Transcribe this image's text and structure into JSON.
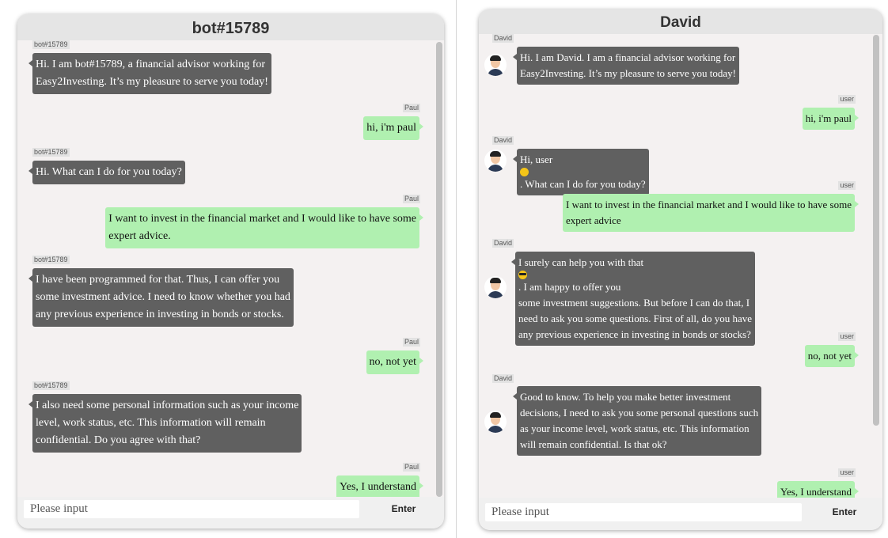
{
  "left_chat": {
    "title": "bot#15789",
    "input_placeholder": "Please input",
    "enter_label": "Enter",
    "messages": [
      {
        "sender": "bot#15789",
        "role": "bot",
        "lines": [
          "Hi. I am bot#15789, a financial advisor working for",
          "Easy2Investing. It’s my pleasure to serve you today!"
        ]
      },
      {
        "sender": "Paul",
        "role": "user",
        "lines": [
          "hi, i'm paul"
        ]
      },
      {
        "sender": "bot#15789",
        "role": "bot",
        "lines": [
          "Hi. What can I do for you today?"
        ]
      },
      {
        "sender": "Paul",
        "role": "user",
        "lines": [
          "I want to invest in the financial market and I would like to have some",
          "expert advice."
        ]
      },
      {
        "sender": "bot#15789",
        "role": "bot",
        "lines": [
          "I have been programmed for that. Thus, I can offer you",
          "some investment advice. I need to know whether you had",
          "any previous experience in investing in bonds or stocks."
        ]
      },
      {
        "sender": "Paul",
        "role": "user",
        "lines": [
          "no, not yet"
        ]
      },
      {
        "sender": "bot#15789",
        "role": "bot",
        "lines": [
          "I also need some personal information such as your income",
          "level, work status, etc. This information will remain",
          "confidential. Do you agree with that?"
        ]
      },
      {
        "sender": "Paul",
        "role": "user",
        "lines": [
          "Yes, I understand"
        ]
      }
    ]
  },
  "right_chat": {
    "title": "David",
    "input_placeholder": "Please input",
    "enter_label": "Enter",
    "messages": [
      {
        "sender": "David",
        "role": "bot",
        "lines": [
          "Hi. I am David. I am a financial advisor working for",
          "Easy2Investing. It’s my pleasure to serve you today!"
        ]
      },
      {
        "sender": "user",
        "role": "user",
        "lines": [
          "hi, i'm paul"
        ]
      },
      {
        "sender": "David",
        "role": "bot",
        "lines": [
          "Hi, user",
          ". What can I do for you today?"
        ]
      },
      {
        "sender": "user",
        "role": "user",
        "lines": [
          "I want to invest in the financial market and I would like to have some",
          "expert advice"
        ]
      },
      {
        "sender": "David",
        "role": "bot",
        "lines": [
          "I surely can help you with that",
          ". I am happy to offer you",
          "some investment suggestions. But before I can do that, I",
          "need to ask you some questions. First of all, do you have",
          "any previous experience in investing in bonds or stocks?"
        ]
      },
      {
        "sender": "user",
        "role": "user",
        "lines": [
          "no, not yet"
        ]
      },
      {
        "sender": "David",
        "role": "bot",
        "lines": [
          "Good to know. To help you make better investment",
          "decisions, I need to ask you some personal questions such",
          "as your income level, work status, etc. This information",
          "will remain confidential. Is that ok?"
        ]
      },
      {
        "sender": "user",
        "role": "user",
        "lines": [
          "Yes, I understand"
        ]
      }
    ]
  },
  "icons": {
    "smile_emoji": "smiling-face-emoji",
    "cool_emoji": "sunglasses-face-emoji",
    "bot_avatar": "avatar-photo"
  }
}
